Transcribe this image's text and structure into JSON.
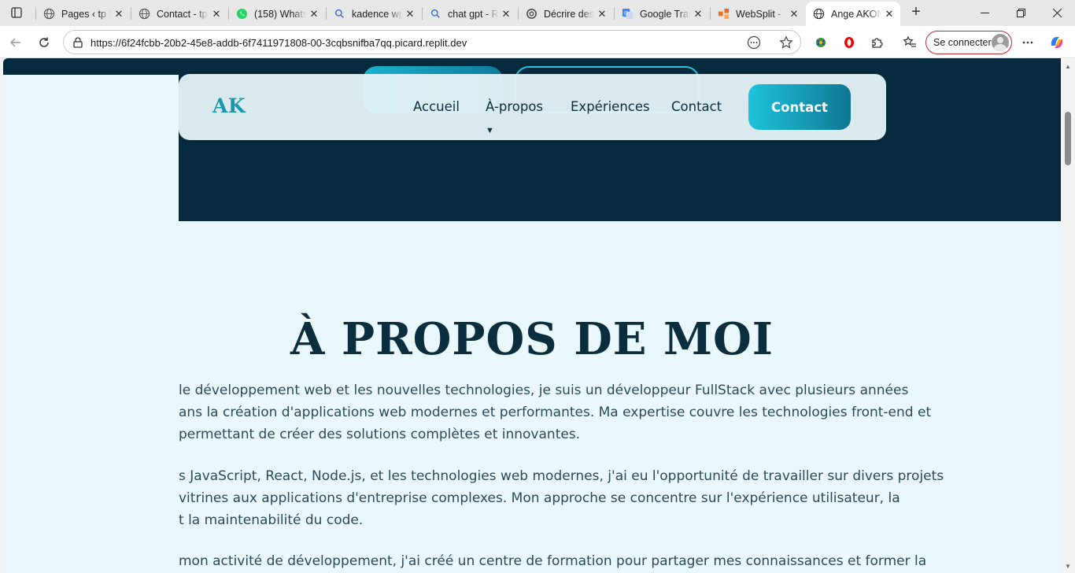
{
  "browser": {
    "tabs": [
      {
        "title": "Pages ‹ tp f",
        "icon": "globe-icon"
      },
      {
        "title": "Contact - tp",
        "icon": "globe-icon"
      },
      {
        "title": "(158) Whats",
        "icon": "whatsapp-icon"
      },
      {
        "title": "kadence wp",
        "icon": "search-icon"
      },
      {
        "title": "chat gpt - R",
        "icon": "search-icon"
      },
      {
        "title": "Décrire des",
        "icon": "openai-icon"
      },
      {
        "title": "Google Trac",
        "icon": "google-translate-icon"
      },
      {
        "title": "WebSplit - ",
        "icon": "websplit-icon"
      },
      {
        "title": "Ange AKON",
        "icon": "globe-icon",
        "active": true
      }
    ],
    "url": "https://6f24fcbb-20b2-45e8-addb-6f7411971808-00-3cqbsnifba7qq.picard.replit.dev",
    "signin_label": "Se connecter",
    "colors": {
      "signin_border": "#c4292f",
      "accent": "#1a96ad"
    }
  },
  "page": {
    "logo": "AK",
    "nav": {
      "links": [
        "Accueil",
        "À-propos",
        "Expériences",
        "Contact"
      ],
      "caret": "▼",
      "cta": "Contact"
    },
    "about": {
      "title": "À PROPOS DE MOI",
      "paragraphs": [
        [
          "le développement web et les nouvelles technologies, je suis un développeur FullStack avec plusieurs années",
          "ans la création d'applications web modernes et performantes. Ma expertise couvre les technologies front-end et",
          "permettant de créer des solutions complètes et innovantes."
        ],
        [
          "s JavaScript, React, Node.js, et les technologies web modernes, j'ai eu l'opportunité de travailler sur divers projets",
          " vitrines aux applications d'entreprise complexes. Mon approche se concentre sur l'expérience utilisateur, la",
          "t la maintenabilité du code."
        ],
        [
          " mon activité de développement, j'ai créé un centre de formation pour partager mes connaissances et former la"
        ]
      ]
    },
    "colors": {
      "dark_band": "#052a3d",
      "background": "#eaf7fc",
      "title": "#0b2e3e",
      "cta_gradient_start": "#1ec3dc",
      "cta_gradient_end": "#0e7694"
    }
  }
}
